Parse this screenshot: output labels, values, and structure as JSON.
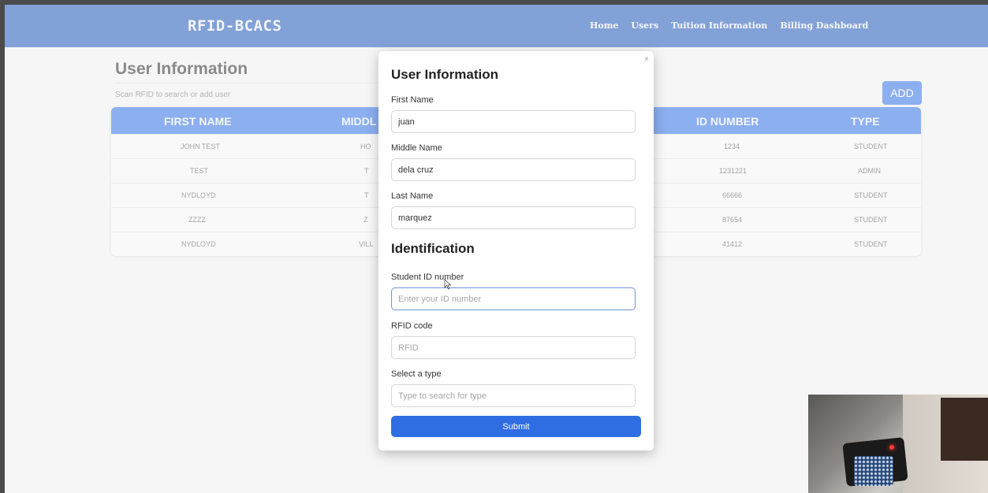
{
  "navbar": {
    "brand": "RFID-BCACS",
    "links": [
      "Home",
      "Users",
      "Tuition Information",
      "Billing Dashboard"
    ]
  },
  "page": {
    "title": "User Information",
    "search_placeholder": "Scan RFID to search or add user",
    "add_label": "ADD"
  },
  "table": {
    "headers": [
      "FIRST NAME",
      "MIDDL",
      "ID NUMBER",
      "TYPE"
    ],
    "rows": [
      {
        "first": "JOHN TEST",
        "middle": "HO",
        "id": "1234",
        "type": "STUDENT"
      },
      {
        "first": "TEST",
        "middle": "T",
        "id": "1231221",
        "type": "ADMIN"
      },
      {
        "first": "NYDLOYD",
        "middle": "T",
        "id": "66666",
        "type": "STUDENT"
      },
      {
        "first": "ZZZZ",
        "middle": "Z",
        "id": "87654",
        "type": "STUDENT"
      },
      {
        "first": "NYDLOYD",
        "middle": "VILL",
        "id": "41412",
        "type": "STUDENT"
      }
    ]
  },
  "modal": {
    "close": "×",
    "title": "User Information",
    "first_name_label": "First Name",
    "first_name_value": "juan",
    "middle_name_label": "Middle Name",
    "middle_name_value": "dela cruz",
    "last_name_label": "Last Name",
    "last_name_value": "marquez",
    "section_identification": "Identification",
    "student_id_label": "Student ID number",
    "student_id_placeholder": "Enter your ID number",
    "rfid_label": "RFID code",
    "rfid_placeholder": "RFID",
    "type_label": "Select a type",
    "type_placeholder": "Type to search for type",
    "submit_label": "Submit"
  },
  "colors": {
    "navbar": "#1d55b4",
    "accent": "#2f6ee2"
  }
}
